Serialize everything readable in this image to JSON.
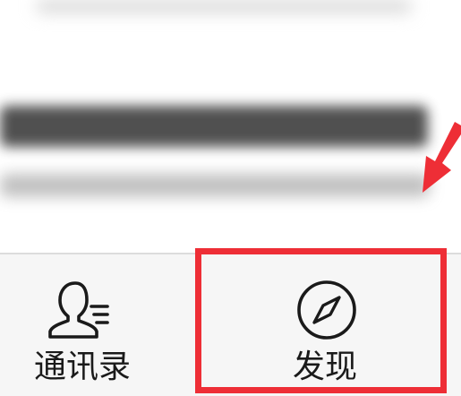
{
  "tabbar": {
    "contacts": {
      "label": "通讯录",
      "icon": "contacts-icon"
    },
    "discover": {
      "label": "发现",
      "icon": "compass-icon"
    }
  },
  "annotation": {
    "color": "#ee2e36"
  }
}
